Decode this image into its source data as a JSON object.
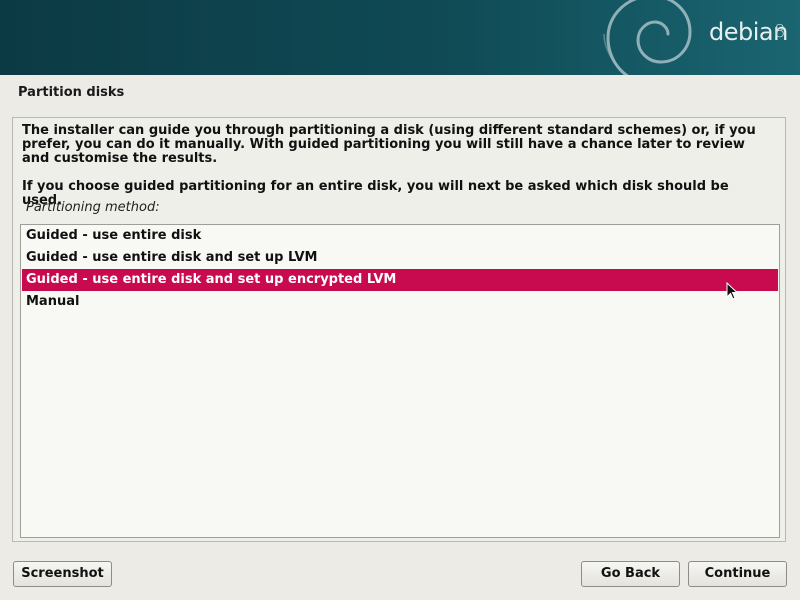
{
  "banner": {
    "logo_text": "debian",
    "logo_version": "8",
    "background_color": "#0f4a55"
  },
  "step": {
    "title": "Partition disks"
  },
  "content": {
    "description": "The installer can guide you through partitioning a disk (using different standard schemes) or, if you prefer, you can do it manually. With guided partitioning you will still have a chance later to review and customise the results.",
    "description2": "If you choose guided partitioning for an entire disk, you will next be asked which disk should be used.",
    "method_label": "Partitioning method:",
    "options": [
      {
        "label": "Guided - use entire disk",
        "selected": false
      },
      {
        "label": "Guided - use entire disk and set up LVM",
        "selected": false
      },
      {
        "label": "Guided - use entire disk and set up encrypted LVM",
        "selected": true
      },
      {
        "label": "Manual",
        "selected": false
      }
    ],
    "selection_color": "#c80a4e"
  },
  "buttons": {
    "screenshot": "Screenshot",
    "go_back": "Go Back",
    "continue": "Continue"
  }
}
